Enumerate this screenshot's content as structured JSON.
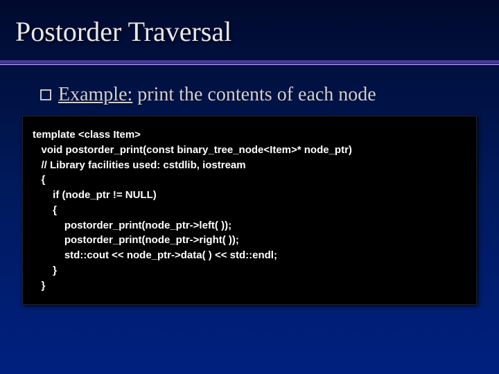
{
  "slide": {
    "title": "Postorder Traversal",
    "bullet": {
      "underlined": "Example:",
      "rest": " print the contents of each node"
    },
    "code": {
      "l1": "template <class Item>",
      "l2": "   void postorder_print(const binary_tree_node<Item>* node_ptr)",
      "l3": "   // Library facilities used: cstdlib, iostream",
      "l4": "   {",
      "l5": "       if (node_ptr != NULL)",
      "l6": "       {",
      "l7": "           postorder_print(node_ptr->left( ));",
      "l8": "           postorder_print(node_ptr->right( ));",
      "l9": "           std::cout << node_ptr->data( ) << std::endl;",
      "l10": "       }",
      "l11": "   }"
    }
  }
}
